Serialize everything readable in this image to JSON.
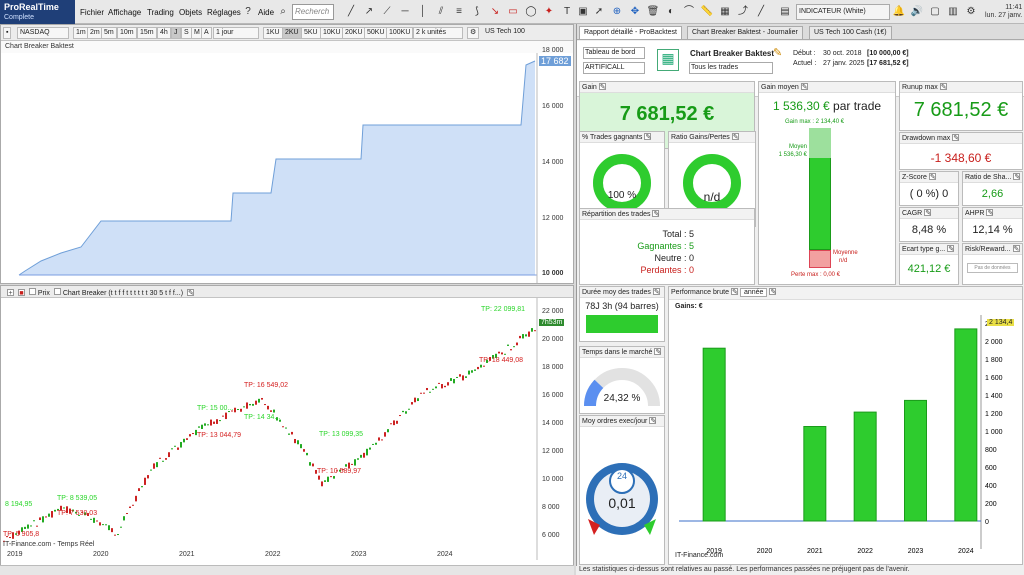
{
  "app": {
    "name": "ProRealTime",
    "edition": "Complete"
  },
  "menu": [
    "Fichier",
    "Affichage",
    "Trading",
    "Objets",
    "Réglages",
    "Aide"
  ],
  "search": {
    "placeholder": "Recherch"
  },
  "indicator": {
    "label": "INDICATEUR (White)"
  },
  "clock": {
    "line1": "11:41",
    "line2": "lun. 27 janv."
  },
  "chart_toolbar": {
    "symbol": "NASDAQ",
    "timeframes": [
      "1m",
      "2m",
      "5m",
      "10m",
      "15m",
      "4h",
      "J",
      "S",
      "M",
      "A"
    ],
    "period": "1 jour",
    "units": [
      "1KU",
      "2KU",
      "5KU",
      "10KU",
      "20KU",
      "50KU",
      "100KU"
    ],
    "units_count": "2 k unités",
    "instrument": "US Tech 100"
  },
  "equity_chart": {
    "title": "Chart Breaker Baktest",
    "last_value": "17 682",
    "yticks": [
      "18 000",
      "16 000",
      "14 000",
      "12 000",
      "10 000"
    ]
  },
  "price_chart": {
    "title": "Chart Breaker (t t f f t t t t t t 30 5 t f f...)",
    "prix_label": "Prix",
    "last_value": "7h53m",
    "yticks": [
      "22 000",
      "20 000",
      "18 000",
      "16 000",
      "14 000",
      "12 000",
      "10 000",
      "8 000",
      "6 000"
    ],
    "xticks": [
      "2019",
      "2020",
      "2021",
      "2022",
      "2023",
      "2024"
    ],
    "source": "IT-Finance.com - Temps Réel",
    "labels": [
      {
        "t": "TP: 22 099,81",
        "c": "#2ad62a"
      },
      {
        "t": "TP: 18 449,08",
        "c": "#d42020"
      },
      {
        "t": "TP: 16 549,02",
        "c": "#d42020"
      },
      {
        "t": "TP: 15 00...",
        "c": "#2ad62a"
      },
      {
        "t": "TP: 14 34...",
        "c": "#2ad62a"
      },
      {
        "t": "TP: 13 044,79",
        "c": "#d42020"
      },
      {
        "t": "TP: 13 099,35",
        "c": "#2ad62a"
      },
      {
        "t": "TP: 10 589,97",
        "c": "#d42020"
      },
      {
        "t": "8 194,95",
        "c": "#2ad62a"
      },
      {
        "t": "TP: 8 539,05",
        "c": "#2ad62a"
      },
      {
        "t": "TP: 7 530,03",
        "c": "#d42020"
      },
      {
        "t": "TP: 5 905,8",
        "c": "#d42020"
      }
    ]
  },
  "report": {
    "tabs": [
      "Rapport détaillé - ProBacktest",
      "Chart Breaker Baktest - Journalier",
      "US Tech 100 Cash (1€)"
    ],
    "dashboard_label": "Tableau de bord",
    "artificall": "ARTIFICALL",
    "strategy_title": "Chart Breaker Baktest",
    "trades_filter": "Tous les trades",
    "start_label": "Début :",
    "start_value": "30 oct. 2018",
    "start_capital": "[10 000,00 €]",
    "end_label": "Actuel :",
    "end_value": "27 janv. 2025",
    "end_capital": "[17 681,52 €]",
    "gain": {
      "label": "Gain",
      "value": "7 681,52 €"
    },
    "gain_moyen": {
      "label": "Gain moyen",
      "value": "1 536,30 €",
      "suffix": "par trade",
      "gain_max": "Gain max : 2 134,40 €",
      "moyen_label": "Moyen",
      "moyen_value": "1 536,30 €",
      "moyenne_label": "Moyenne",
      "moyenne_value": "n/d",
      "perte_max": "Perte max : 0,00 €"
    },
    "runup": {
      "label": "Runup max",
      "value": "7 681,52 €"
    },
    "pct_gagnants": {
      "label": "% Trades gagnants",
      "value": "100 %",
      "fraction": 1.0
    },
    "ratio": {
      "label": "Ratio Gains/Pertes",
      "value": "n/d"
    },
    "drawdown": {
      "label": "Drawdown max",
      "value": "-1 348,60 €"
    },
    "zscore": {
      "label": "Z-Score",
      "value": "( 0 %) 0"
    },
    "sharpe": {
      "label": "Ratio de Sha...",
      "value": "2,66"
    },
    "cagr": {
      "label": "CAGR",
      "value": "8,48 %"
    },
    "ahpr": {
      "label": "AHPR",
      "value": "12,14 %"
    },
    "ecart": {
      "label": "Ecart type g...",
      "value": "421,12 €"
    },
    "riskreward": {
      "label": "Risk/Reward...",
      "button": "Pas de données"
    },
    "repartition": {
      "label": "Répartition des trades",
      "total_label": "Total :",
      "total": "5",
      "gagnantes_label": "Gagnantes :",
      "gagnantes": "5",
      "neutre_label": "Neutre :",
      "neutre": "0",
      "perdantes_label": "Perdantes :",
      "perdantes": "0"
    },
    "duree": {
      "label": "Durée moy des trades",
      "value": "78J 3h (94 barres)"
    },
    "temps": {
      "label": "Temps dans le marché",
      "value": "24,32 %",
      "fraction": 0.2432
    },
    "ordres": {
      "label": "Moy ordres exec/jour",
      "value": "0,01",
      "dial": "24"
    },
    "perf": {
      "label": "Performance brute",
      "period": "année",
      "gains_label": "Gains: €",
      "last_value": "2 134,4",
      "source": "IT-Finance.com",
      "yticks": [
        "2 200",
        "2 000",
        "1 800",
        "1 600",
        "1 400",
        "1 200",
        "1 000",
        "800",
        "600",
        "400",
        "200",
        "0"
      ]
    },
    "footer": "Les statistiques ci-dessus sont relatives au passé. Les performances passées ne préjugent pas de l'avenir."
  },
  "colors": {
    "accent": "#1f3f78",
    "green": "#2ecc2e",
    "red": "#c8201d",
    "equity_fill": "#cfe0f7",
    "equity_line": "#6f9fd8"
  },
  "chart_data": {
    "type": "bar",
    "title": "Performance brute",
    "categories": [
      "2019",
      "2020",
      "2021",
      "2022",
      "2023",
      "2024"
    ],
    "values": [
      1920,
      0,
      1050,
      1210,
      1340,
      2134.4
    ],
    "ylim": [
      -200,
      2200
    ]
  }
}
